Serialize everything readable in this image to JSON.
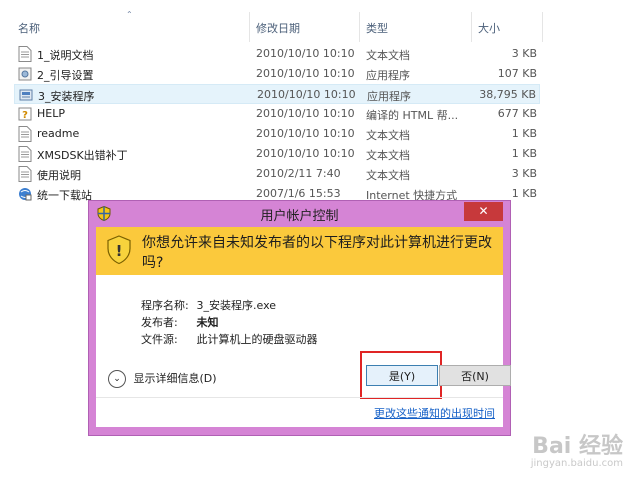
{
  "explorer": {
    "columns": {
      "name": "名称",
      "date": "修改日期",
      "type": "类型",
      "size": "大小"
    },
    "files": [
      {
        "name": "1_说明文档",
        "date": "2010/10/10 10:10",
        "type": "文本文档",
        "size": "3 KB",
        "icon": "text-file-icon"
      },
      {
        "name": "2_引导设置",
        "date": "2010/10/10 10:10",
        "type": "应用程序",
        "size": "107 KB",
        "icon": "app-settings-icon"
      },
      {
        "name": "3_安装程序",
        "date": "2010/10/10 10:10",
        "type": "应用程序",
        "size": "38,795 KB",
        "icon": "installer-icon",
        "selected": true
      },
      {
        "name": "HELP",
        "date": "2010/10/10 10:10",
        "type": "编译的 HTML 帮...",
        "size": "677 KB",
        "icon": "help-file-icon"
      },
      {
        "name": "readme",
        "date": "2010/10/10 10:10",
        "type": "文本文档",
        "size": "1 KB",
        "icon": "text-file-icon"
      },
      {
        "name": "XMSDSK出错补丁",
        "date": "2010/10/10 10:10",
        "type": "文本文档",
        "size": "1 KB",
        "icon": "text-file-icon"
      },
      {
        "name": "使用说明",
        "date": "2010/2/11 7:40",
        "type": "文本文档",
        "size": "3 KB",
        "icon": "text-file-icon"
      },
      {
        "name": "统一下载站",
        "date": "2007/1/6 15:53",
        "type": "Internet 快捷方式",
        "size": "1 KB",
        "icon": "internet-shortcut-icon"
      }
    ]
  },
  "uac": {
    "title": "用户帐户控制",
    "close_label": "✕",
    "question": "你想允许来自未知发布者的以下程序对此计算机进行更改吗?",
    "fields": [
      {
        "key": "程序名称:",
        "value": "3_安装程序.exe",
        "bold": false
      },
      {
        "key": "发布者:",
        "value": "未知",
        "bold": true
      },
      {
        "key": "文件源:",
        "value": "此计算机上的硬盘驱动器",
        "bold": false
      }
    ],
    "details_label": "显示详细信息(D)",
    "yes_label": "是(Y)",
    "no_label": "否(N)",
    "link_text": "更改这些通知的出现时间",
    "colors": {
      "frame": "#d584d5",
      "warning_band": "#fbc93c",
      "close_button": "#c7393b",
      "highlight_box": "#e02525"
    }
  },
  "watermark": {
    "main": "Bai 经验",
    "sub": "jingyan.baidu.com"
  }
}
